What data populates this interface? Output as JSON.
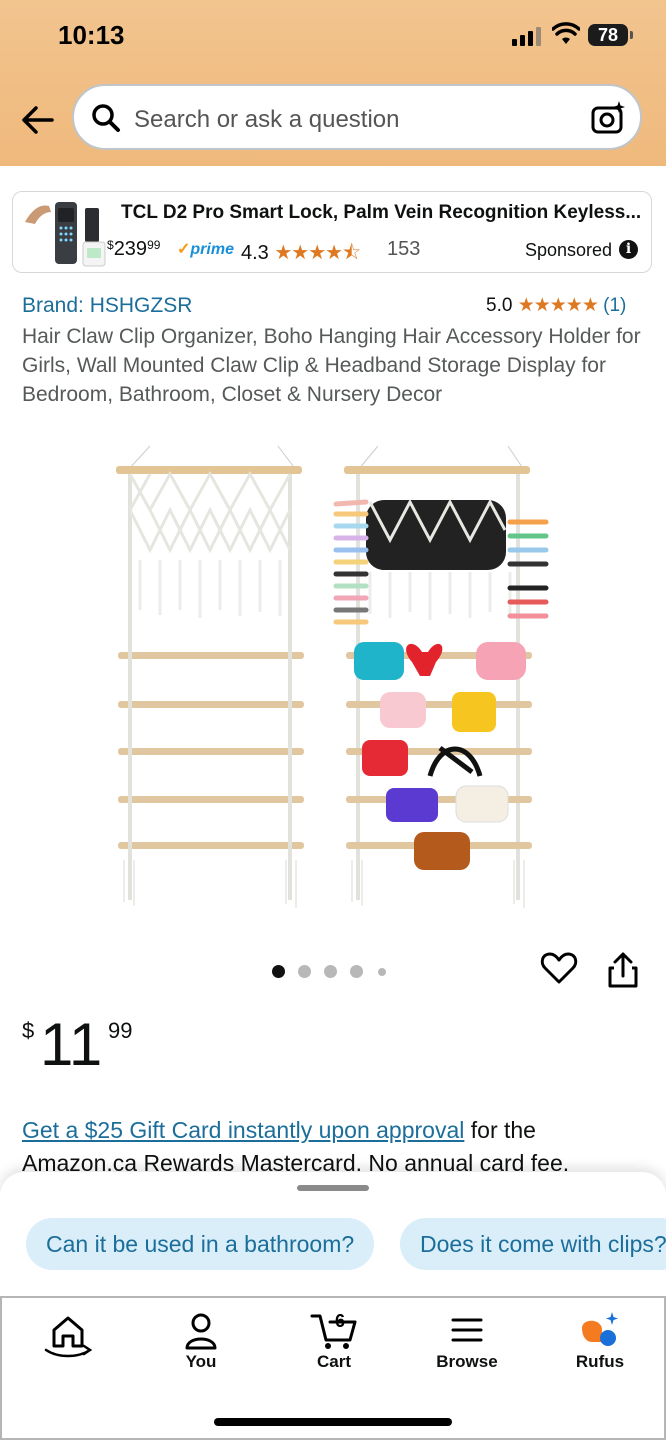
{
  "status_bar": {
    "time": "10:13",
    "battery": "78"
  },
  "search": {
    "placeholder": "Search or ask a question"
  },
  "sponsored": {
    "title": "TCL D2 Pro Smart Lock, Palm Vein Recognition Keyless...",
    "price_symbol": "$",
    "price_whole": "239",
    "price_fraction": "99",
    "prime": "prime",
    "rating": "4.3",
    "stars": "★★★★⯪",
    "count": "153",
    "label": "Sponsored"
  },
  "product": {
    "brand": "Brand: HSHGZSR",
    "rating_value": "5.0",
    "rating_stars": "★★★★★",
    "rating_count": "(1)",
    "title": "Hair Claw Clip Organizer, Boho Hanging Hair Accessory Holder for Girls, Wall Mounted Claw Clip & Headband Storage Display for Bedroom, Bathroom, Closet & Nursery Decor",
    "image_count": 5,
    "image_index": 1,
    "price_currency": "$",
    "price_whole": "11",
    "price_fraction": "99"
  },
  "promo": {
    "link_text": "Get a $25 Gift Card instantly upon approval",
    "rest_text": " for the Amazon.ca Rewards Mastercard. No annual card fee."
  },
  "rufus_chips": [
    "Can it be used in a bathroom?",
    "Does it come with clips?"
  ],
  "tabs": [
    {
      "label": "",
      "icon": "home-icon"
    },
    {
      "label": "You",
      "icon": "person-icon"
    },
    {
      "label": "Cart",
      "icon": "cart-icon",
      "badge": "6"
    },
    {
      "label": "Browse",
      "icon": "menu-icon"
    },
    {
      "label": "Rufus",
      "icon": "rufus-icon"
    }
  ]
}
